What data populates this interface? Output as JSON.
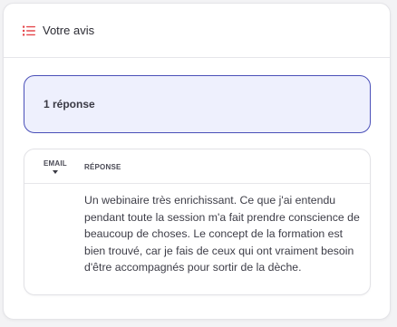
{
  "header": {
    "icon": "list-icon",
    "title": "Votre avis"
  },
  "summary": {
    "text": "1 réponse"
  },
  "table": {
    "columns": {
      "email": "EMAIL",
      "response": "RÉPONSE"
    },
    "rows": [
      {
        "email": "",
        "response": "Un webinaire très enrichissant. Ce que j'ai entendu pendant toute la session m'a fait prendre conscience de beaucoup de choses. Le concept de la formation est bien trouvé, car je fais de ceux qui ont vraiment besoin d'être accompagnés pour sortir de la dèche."
      }
    ]
  },
  "colors": {
    "accent_icon": "#e5484d",
    "summary_border": "#4a4fb8",
    "summary_bg": "#eef0fd"
  }
}
